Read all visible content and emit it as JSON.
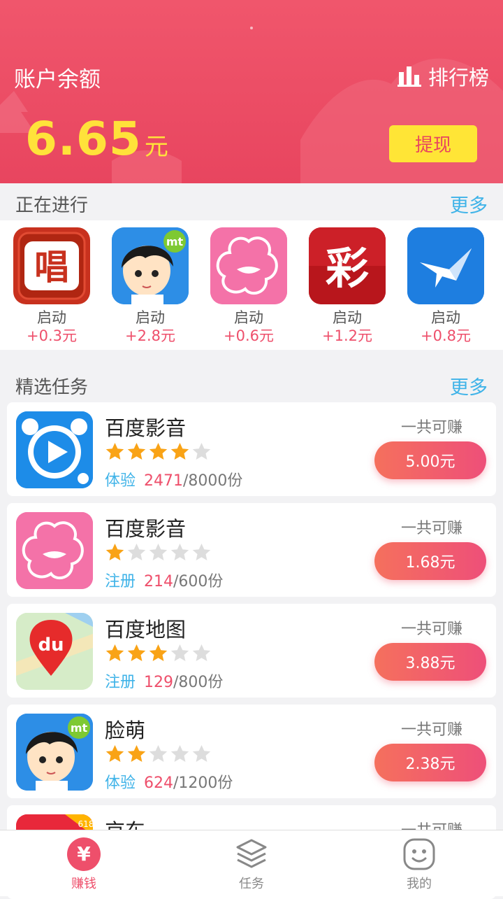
{
  "header": {
    "account_label": "账户余额",
    "ranking_label": "排行榜",
    "balance_value": "6.65",
    "balance_unit": "元",
    "withdraw_label": "提现"
  },
  "ongoing": {
    "title": "正在进行",
    "more": "更多",
    "items": [
      {
        "icon": "sing-app-icon",
        "action": "启动",
        "reward": "+0.3元"
      },
      {
        "icon": "cartoon-boy-app-icon",
        "action": "启动",
        "reward": "+2.8元"
      },
      {
        "icon": "pink-flower-lips-app-icon",
        "action": "启动",
        "reward": "+0.6元"
      },
      {
        "icon": "lottery-app-icon",
        "action": "启动",
        "reward": "+1.2元"
      },
      {
        "icon": "blue-bird-app-icon",
        "action": "启动",
        "reward": "+0.8元"
      }
    ]
  },
  "tasks": {
    "title": "精选任务",
    "more": "更多",
    "earn_label": "一共可赚",
    "items": [
      {
        "name": "百度影音",
        "stars": 4,
        "type": "体验",
        "done": "2471",
        "total": "/8000份",
        "reward": "5.00元",
        "icon": "play-app-icon"
      },
      {
        "name": "百度影音",
        "stars": 1,
        "type": "注册",
        "done": "214",
        "total": "/600份",
        "reward": "1.68元",
        "icon": "pink-flower-lips-app-icon"
      },
      {
        "name": "百度地图",
        "stars": 3,
        "type": "注册",
        "done": "129",
        "total": "/800份",
        "reward": "3.88元",
        "icon": "map-pin-app-icon"
      },
      {
        "name": "脸萌",
        "stars": 2,
        "type": "体验",
        "done": "624",
        "total": "/1200份",
        "reward": "2.38元",
        "icon": "cartoon-boy-app-icon"
      },
      {
        "name": "京东",
        "icon": "jd-app-icon",
        "reward_label": "一共可赚"
      }
    ]
  },
  "nav": {
    "earn": "赚钱",
    "earn_icon_glyph": "¥",
    "tasks": "任务",
    "mine": "我的"
  },
  "colors": {
    "header": "#ee5269",
    "balance": "#ffe23a",
    "accent": "#ee4f6b",
    "link": "#3fb3e8",
    "star_on": "#f9a316",
    "star_off": "#dddddd"
  }
}
